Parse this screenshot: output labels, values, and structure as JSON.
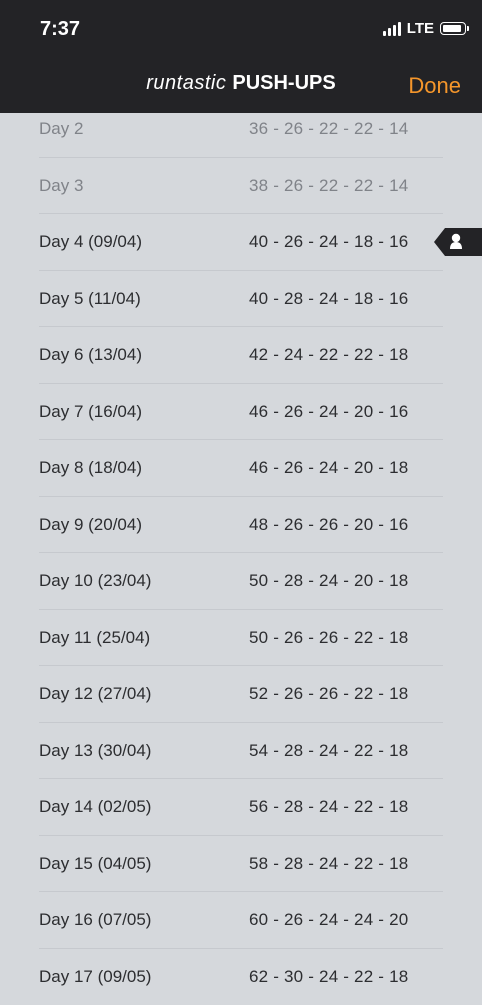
{
  "status_bar": {
    "time": "7:37",
    "network": "LTE"
  },
  "header": {
    "brand": "runtastic",
    "app_title": "PUSH-UPS",
    "done_label": "Done"
  },
  "schedule": [
    {
      "day": "Day 2",
      "reps": "36 - 26 - 22 - 22 - 14"
    },
    {
      "day": "Day 3",
      "reps": "38 - 26 - 22 - 22 - 14"
    },
    {
      "day": "Day 4 (09/04)",
      "reps": "40 - 26 - 24 - 18 - 16"
    },
    {
      "day": "Day 5 (11/04)",
      "reps": "40 - 28 - 24 - 18 - 16"
    },
    {
      "day": "Day 6 (13/04)",
      "reps": "42 - 24 - 22 - 22 - 18"
    },
    {
      "day": "Day 7 (16/04)",
      "reps": "46 - 26 - 24 - 20 - 16"
    },
    {
      "day": "Day 8 (18/04)",
      "reps": "46 - 26 - 24 - 20 - 18"
    },
    {
      "day": "Day 9 (20/04)",
      "reps": "48 - 26 - 26 - 20 - 16"
    },
    {
      "day": "Day 10 (23/04)",
      "reps": "50 - 28 - 24 - 20 - 18"
    },
    {
      "day": "Day 11 (25/04)",
      "reps": "50 - 26 - 26 - 22 - 18"
    },
    {
      "day": "Day 12 (27/04)",
      "reps": "52 - 26 - 26 - 22 - 18"
    },
    {
      "day": "Day 13 (30/04)",
      "reps": "54 - 28 - 24 - 22 - 18"
    },
    {
      "day": "Day 14 (02/05)",
      "reps": "56 - 28 - 24 - 22 - 18"
    },
    {
      "day": "Day 15 (04/05)",
      "reps": "58 - 28 - 24 - 22 - 18"
    },
    {
      "day": "Day 16 (07/05)",
      "reps": "60 - 26 - 24 - 24 - 20"
    },
    {
      "day": "Day 17 (09/05)",
      "reps": "62 - 30 - 24 - 22 - 18"
    }
  ],
  "current_marker": {
    "icon": "user-silhouette-icon",
    "row_day": "Day 4 (09/04)"
  },
  "colors": {
    "header_bg": "#232326",
    "accent": "#f5962b",
    "list_bg": "#d5d8dc"
  }
}
